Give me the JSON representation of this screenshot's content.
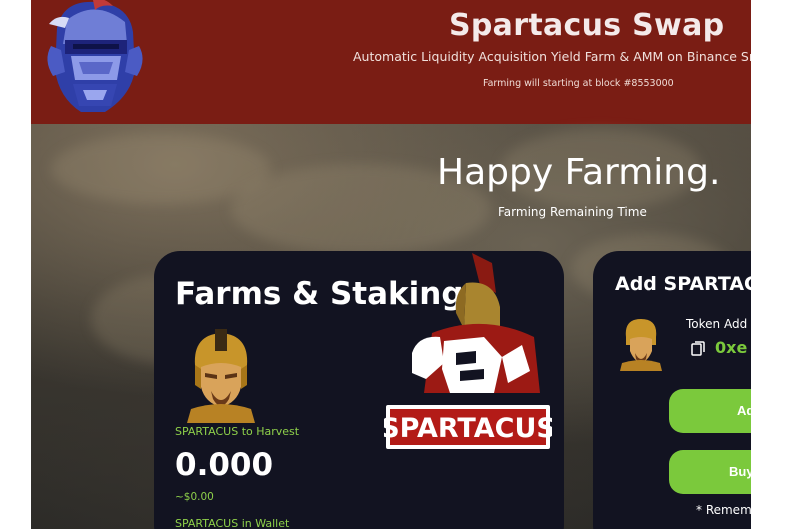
{
  "header": {
    "title": "Spartacus Swap",
    "subtitle": "Automatic Liquidity Acquisition Yield Farm & AMM on Binance Sma",
    "block_note": "Farming will starting at block #8553000",
    "logo_icon": "knight-mascot-icon"
  },
  "hero": {
    "heading": "Happy Farming.",
    "remaining_label": "Farming Remaining Time"
  },
  "farms_card": {
    "title": "Farms & Staking",
    "harvest_label": "SPARTACUS to Harvest",
    "harvest_value": "0.000",
    "harvest_usd": "~$0.00",
    "wallet_label": "SPARTACUS in Wallet",
    "brand_logo_text": "SPARTACUS",
    "token_icon": "spartan-warrior-icon"
  },
  "add_card": {
    "title": "Add SPARTAC",
    "token_label": "Token Add",
    "token_address": "0xe",
    "copy_icon": "copy-icon",
    "add_button_label": "Add $",
    "buy_button_label": "Buy $SF",
    "remember_note": "* Remem"
  },
  "colors": {
    "header_bg": "#7a1d14",
    "card_bg": "#121321",
    "accent_green": "#7bc93c"
  }
}
